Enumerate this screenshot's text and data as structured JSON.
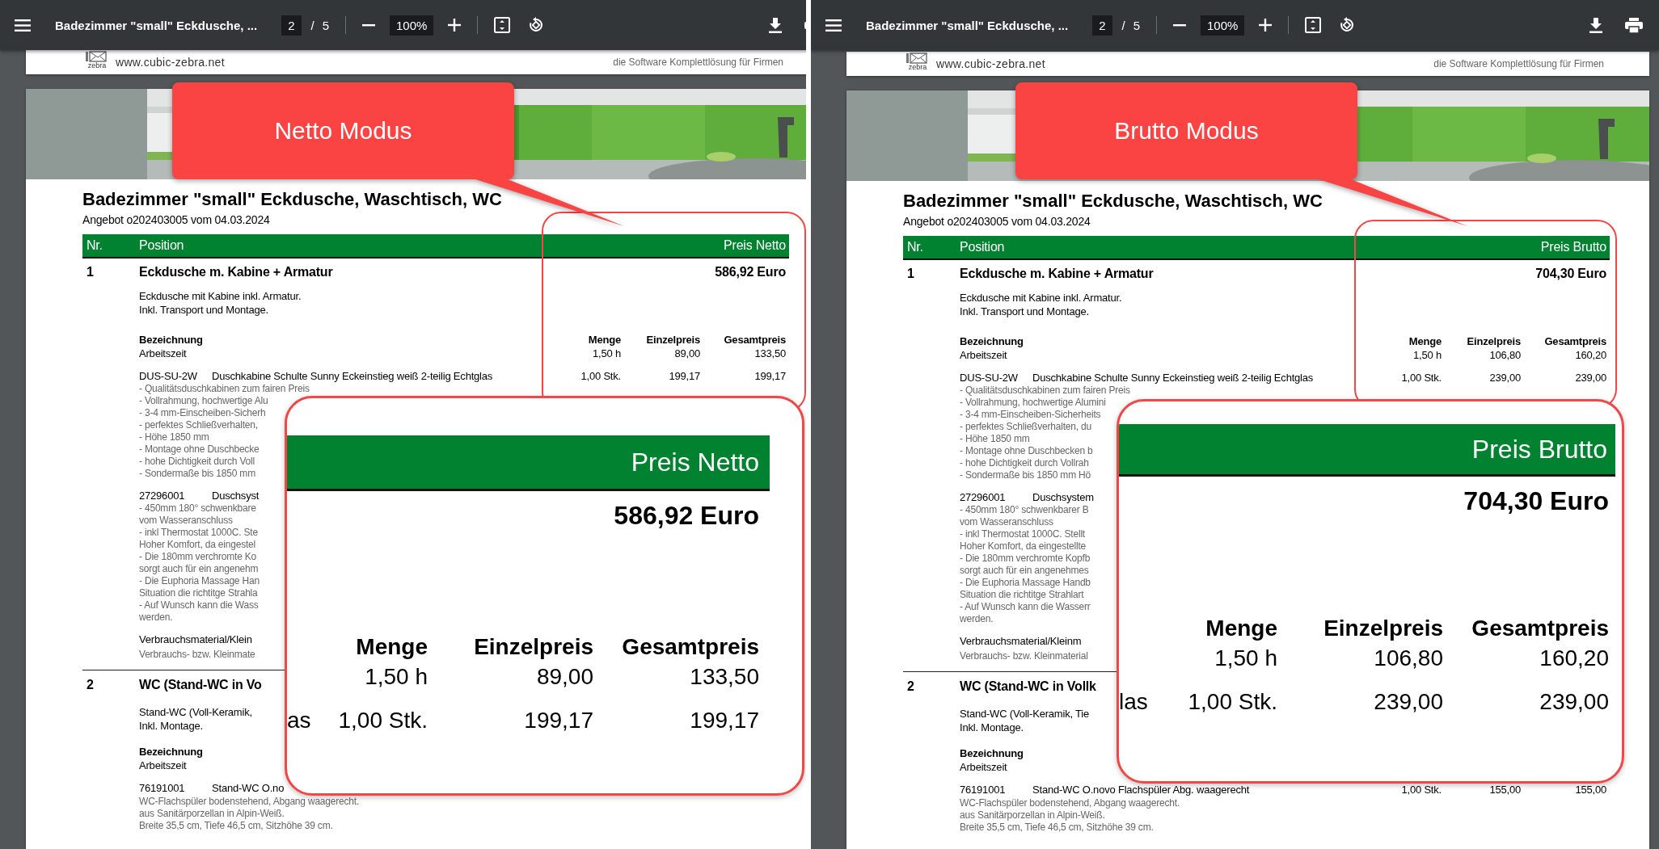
{
  "panes": [
    {
      "toolbar": {
        "title": "Badezimmer \"small\" Eckdusche, ...",
        "page": "2",
        "separator": "/",
        "page_count": "5",
        "zoom": "100%"
      },
      "header": {
        "logo_text": "zebra",
        "url": "www.cubic-zebra.net",
        "tagline": "die Software Komplettlösung für Firmen"
      },
      "document": {
        "title": "Badezimmer \"small\" Eckdusche, Waschtisch, WC",
        "subtitle": "Angebot o202403005 vom 04.03.2024",
        "columns": [
          "Nr.",
          "Position",
          "Preis Netto"
        ],
        "items": [
          {
            "nr": "1",
            "name": "Eckdusche m. Kabine + Armatur",
            "price": "586,92 Euro",
            "description": [
              "Eckdusche mit Kabine inkl. Armatur.",
              "Inkl. Transport und Montage."
            ],
            "sub_header": {
              "label": "Bezeichnung",
              "quantity": "Menge",
              "unit_price": "Einzelpreis",
              "total_price": "Gesamtpreis"
            },
            "lines": [
              {
                "kind": "labor",
                "name": "Arbeitszeit",
                "quantity": "1,50 h",
                "unit_price": "89,00",
                "total_price": "133,50"
              },
              {
                "kind": "article",
                "code": "DUS-SU-2W",
                "name": "Duschkabine Schulte Sunny Eckeinstieg weiß 2-teilig Echtglas",
                "quantity": "1,00 Stk.",
                "unit_price": "199,17",
                "total_price": "199,17",
                "notes": [
                  "- Qualitätsduschkabinen zum fairen Preis",
                  "- Vollrahmung, hochwertige Alu",
                  "- 3-4 mm-Einscheiben-Sicherh",
                  "- perfektes Schließverhalten,",
                  "- Höhe 1850 mm",
                  "- Montage ohne Duschbecke",
                  "- hohe Dichtigkeit durch Voll",
                  "- Sondermaße bis 1850 mm"
                ]
              },
              {
                "kind": "article",
                "code": "27296001",
                "name": "Duschsyst",
                "notes": [
                  "- 450mm 180° schwenkbare",
                  "vom Wasseranschluss",
                  "- inkl Thermostat 1000C. Ste",
                  "Hoher Komfort, da eingestel",
                  "- Die 180mm verchromte Ko",
                  "sorgt auch für ein angenehm",
                  "- Die Euphoria Massage Han",
                  "Situation die richtitge Strahla",
                  "- Auf Wunsch kann die Wass",
                  "werden."
                ]
              },
              {
                "kind": "material",
                "name": "Verbrauchsmaterial/Klein",
                "notes": [
                  "Verbrauchs- bzw. Kleinmate"
                ]
              }
            ]
          },
          {
            "nr": "2",
            "name": "WC (Stand-WC in Vo",
            "description": [
              "Stand-WC (Voll-Keramik,",
              "Inkl. Montage."
            ],
            "sub_header": {
              "label": "Bezeichnung"
            },
            "lines": [
              {
                "kind": "labor",
                "name": "Arbeitszeit"
              },
              {
                "kind": "article",
                "code": "76191001",
                "name": "Stand-WC O.no",
                "notes": [
                  "WC-Flachspüler bodenstehend, Abgang waagerecht.",
                  "aus Sanitärporzellan in Alpin-Weiß.",
                  "Breite 35,5 cm, Tiefe 46,5 cm, Sitzhöhe 39 cm."
                ]
              }
            ]
          }
        ]
      },
      "callout": {
        "text": "Netto Modus"
      },
      "zoom_inset": {
        "column": "Preis Netto",
        "total": "586,92 Euro",
        "headers": [
          "Menge",
          "Einzelpreis",
          "Gesamtpreis"
        ],
        "rows": [
          {
            "values": [
              "1,50 h",
              "89,00",
              "133,50"
            ]
          },
          {
            "label": "as",
            "values": [
              "1,00 Stk.",
              "199,17",
              "199,17"
            ]
          }
        ]
      }
    },
    {
      "toolbar": {
        "title": "Badezimmer \"small\" Eckdusche, ...",
        "page": "2",
        "separator": "/",
        "page_count": "5",
        "zoom": "100%"
      },
      "header": {
        "logo_text": "zebra",
        "url": "www.cubic-zebra.net",
        "tagline": "die Software Komplettlösung für Firmen"
      },
      "document": {
        "title": "Badezimmer \"small\" Eckdusche, Waschtisch, WC",
        "subtitle": "Angebot o202403005 vom 04.03.2024",
        "columns": [
          "Nr.",
          "Position",
          "Preis Brutto"
        ],
        "items": [
          {
            "nr": "1",
            "name": "Eckdusche m. Kabine + Armatur",
            "price": "704,30 Euro",
            "description": [
              "Eckdusche mit Kabine inkl. Armatur.",
              "Inkl. Transport und Montage."
            ],
            "sub_header": {
              "label": "Bezeichnung",
              "quantity": "Menge",
              "unit_price": "Einzelpreis",
              "total_price": "Gesamtpreis"
            },
            "lines": [
              {
                "kind": "labor",
                "name": "Arbeitszeit",
                "quantity": "1,50 h",
                "unit_price": "106,80",
                "total_price": "160,20"
              },
              {
                "kind": "article",
                "code": "DUS-SU-2W",
                "name": "Duschkabine Schulte Sunny Eckeinstieg weiß 2-teilig Echtglas",
                "quantity": "1,00 Stk.",
                "unit_price": "239,00",
                "total_price": "239,00",
                "notes": [
                  "- Qualitätsduschkabinen zum fairen Preis",
                  "- Vollrahmung, hochwertige Alumini",
                  "- 3-4 mm-Einscheiben-Sicherheits",
                  "- perfektes Schließverhalten, du",
                  "- Höhe 1850 mm",
                  "- Montage ohne Duschbecken b",
                  "- hohe Dichtigkeit durch Vollrah",
                  "- Sondermaße bis 1850 mm Hö"
                ]
              },
              {
                "kind": "article",
                "code": "27296001",
                "name": "Duschsystem",
                "notes": [
                  "- 450mm 180° schwenkbarer B",
                  "vom Wasseranschluss",
                  "- inkl Thermostat 1000C. Stellt",
                  "Hoher Komfort, da eingestellte",
                  "- Die 180mm verchromte Kopfb",
                  "sorgt auch für ein angenehmes",
                  "- Die Euphoria Massage Handb",
                  "Situation die richtitge Strahlart",
                  "- Auf Wunsch kann die Wasserr",
                  "werden."
                ]
              },
              {
                "kind": "material",
                "name": "Verbrauchsmaterial/Kleinm",
                "notes": [
                  "Verbrauchs- bzw. Kleinmaterial"
                ]
              }
            ]
          },
          {
            "nr": "2",
            "name": "WC (Stand-WC in Vollk",
            "description": [
              "Stand-WC (Voll-Keramik, Tie",
              "Inkl. Montage."
            ],
            "sub_header": {
              "label": "Bezeichnung"
            },
            "lines": [
              {
                "kind": "labor",
                "name": "Arbeitszeit"
              },
              {
                "kind": "article",
                "code": "76191001",
                "name": "Stand-WC O.novo Flachspüler Abg. waagerecht",
                "quantity": "1,00 Stk.",
                "unit_price": "155,00",
                "total_price": "155,00",
                "notes": [
                  "WC-Flachspüler bodenstehend, Abgang waagerecht.",
                  "aus Sanitärporzellan in Alpin-Weiß.",
                  "Breite 35,5 cm, Tiefe 46,5 cm, Sitzhöhe 39 cm."
                ]
              }
            ]
          }
        ]
      },
      "callout": {
        "text": "Brutto Modus"
      },
      "zoom_inset": {
        "column": "Preis Brutto",
        "total": "704,30 Euro",
        "headers": [
          "Menge",
          "Einzelpreis",
          "Gesamtpreis"
        ],
        "rows": [
          {
            "values": [
              "1,50 h",
              "106,80",
              "160,20"
            ]
          },
          {
            "label": "las",
            "values": [
              "1,00 Stk.",
              "239,00",
              "239,00"
            ]
          }
        ]
      }
    }
  ]
}
